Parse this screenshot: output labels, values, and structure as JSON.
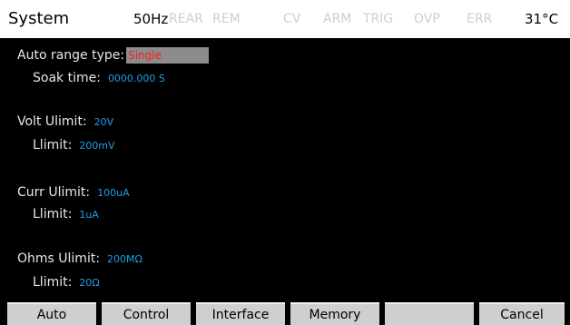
{
  "status_bar": {
    "title": "System",
    "frequency": "50Hz",
    "indicators": [
      "REAR",
      "REM",
      "CV",
      "ARM",
      "TRIG",
      "OVP",
      "ERR"
    ],
    "temperature": "31°C"
  },
  "settings": {
    "auto_range_type": {
      "label": "Auto range type:",
      "value": "Single"
    },
    "soak_time": {
      "label": "Soak time:",
      "value": "0000.000 S"
    },
    "volt": {
      "ulimit": {
        "label": "Volt Ulimit:",
        "value": "20V"
      },
      "llimit": {
        "label": "Llimit:",
        "value": "200mV"
      }
    },
    "curr": {
      "ulimit": {
        "label": "Curr Ulimit:",
        "value": "100uA"
      },
      "llimit": {
        "label": "Llimit:",
        "value": "1uA"
      }
    },
    "ohms": {
      "ulimit": {
        "label": "Ohms Ulimit:",
        "value": "200MΩ"
      },
      "llimit": {
        "label": "Llimit:",
        "value": "20Ω"
      }
    }
  },
  "softkeys": [
    "Auto",
    "Control",
    "Interface",
    "Memory",
    "",
    "Cancel"
  ],
  "colors": {
    "background": "#000000",
    "status_bar": "#ffffff",
    "value_blue": "#1e9de6",
    "value_red": "#ff1a1a",
    "inactive_indicator": "#cfcfcf",
    "softkey": "#cfcfcf",
    "selection_box": "#8c8c8c"
  }
}
